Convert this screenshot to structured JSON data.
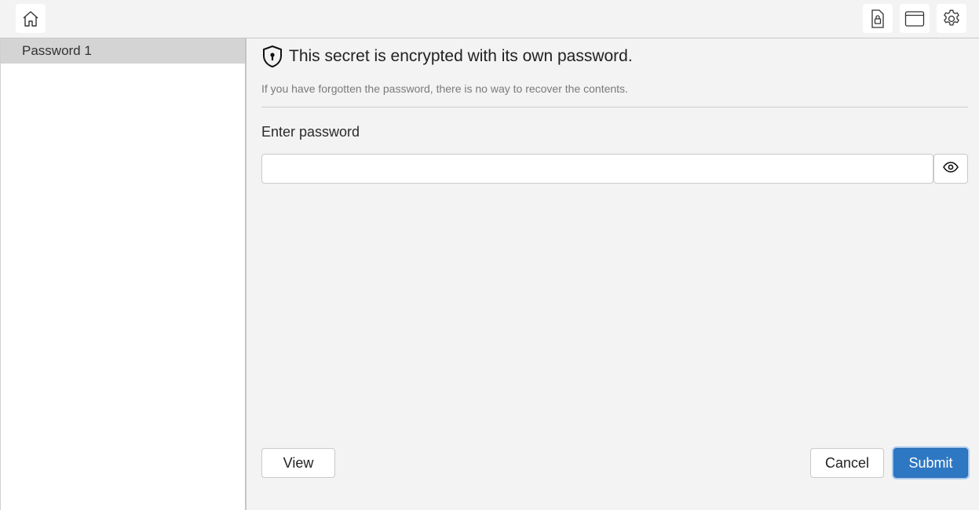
{
  "toolbar": {
    "home_icon": "home-icon",
    "lock_icon": "lock-file-icon",
    "window_icon": "window-icon",
    "settings_icon": "gear-icon"
  },
  "sidebar": {
    "items": [
      {
        "label": "Password 1",
        "selected": true
      }
    ]
  },
  "main": {
    "heading_icon": "shield-keyhole-icon",
    "heading": "This secret is encrypted with its own password.",
    "subtext": "If you have forgotten the password, there is no way to recover the contents.",
    "password_label": "Enter password",
    "password_value": "",
    "password_placeholder": "",
    "reveal_icon": "eye-icon",
    "view_label": "View",
    "cancel_label": "Cancel",
    "submit_label": "Submit"
  },
  "colors": {
    "accent": "#2e77c3",
    "selected_row": "#d4d4d4",
    "background": "#f3f3f3"
  }
}
